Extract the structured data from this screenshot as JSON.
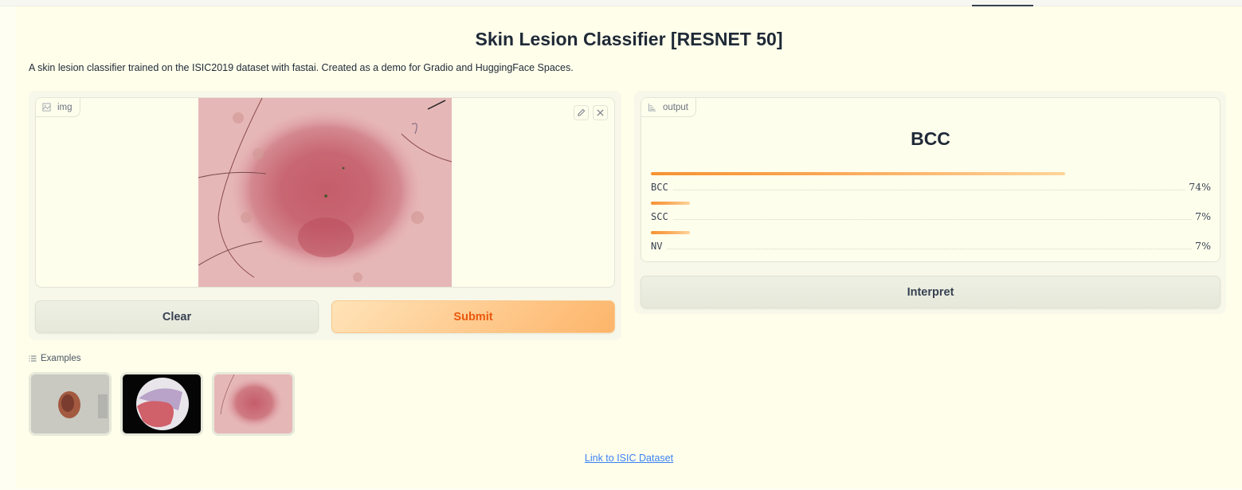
{
  "app": {
    "title": "Skin Lesion Classifier [RESNET 50]",
    "description": "A skin lesion classifier trained on the ISIC2019 dataset with fastai. Created as a demo for Gradio and HuggingFace Spaces."
  },
  "input": {
    "label": "img",
    "label_icon": "image-icon",
    "edit_icon": "pencil-icon",
    "close_icon": "close-icon"
  },
  "buttons": {
    "clear": "Clear",
    "submit": "Submit",
    "interpret": "Interpret"
  },
  "output": {
    "label": "output",
    "label_icon": "bar-chart-icon",
    "predicted_label": "BCC",
    "confidences": [
      {
        "label": "BCC",
        "value": 0.74,
        "display": "74%"
      },
      {
        "label": "SCC",
        "value": 0.07,
        "display": "7%"
      },
      {
        "label": "NV",
        "value": 0.07,
        "display": "7%"
      }
    ]
  },
  "examples": {
    "label": "Examples",
    "label_icon": "list-icon",
    "items": [
      {
        "name": "example-1"
      },
      {
        "name": "example-2"
      },
      {
        "name": "example-3"
      }
    ]
  },
  "footer": {
    "link_text": "Link to ISIC Dataset"
  },
  "colors": {
    "accent": "#ea580c",
    "bar_start": "#f79232",
    "bar_end": "#fdd49a",
    "link": "#3b82f6",
    "background": "#fefeea"
  }
}
